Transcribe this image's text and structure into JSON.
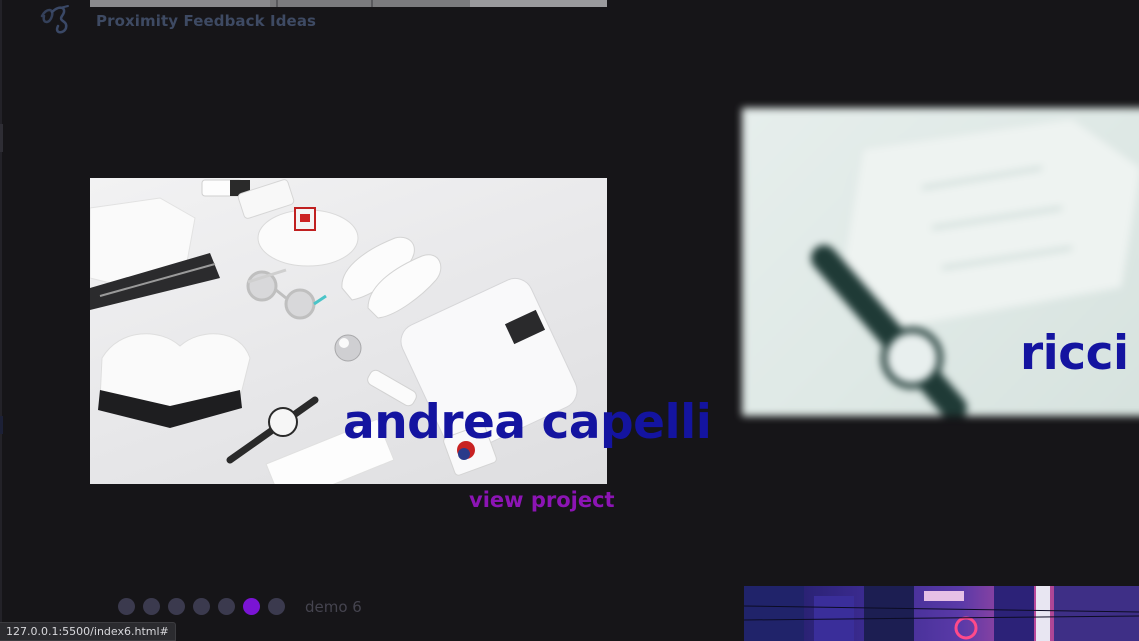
{
  "header": {
    "brand_title": "Proximity Feedback Ideas",
    "logo_icon": "scribble-logo-icon"
  },
  "slides": {
    "current": {
      "title": "andrea capelli",
      "link_label": "view project"
    },
    "next": {
      "title": "ricci h"
    }
  },
  "pagination": {
    "dots": [
      {
        "index": 1,
        "active": false
      },
      {
        "index": 2,
        "active": false
      },
      {
        "index": 3,
        "active": false
      },
      {
        "index": 4,
        "active": false
      },
      {
        "index": 5,
        "active": false
      },
      {
        "index": 6,
        "active": true
      },
      {
        "index": 7,
        "active": false
      }
    ],
    "label": "demo 6"
  },
  "status_bar": {
    "url": "127.0.0.1:5500/index6.html#"
  },
  "colors": {
    "background": "#161518",
    "title": "#1414a0",
    "link": "#8c14b4",
    "dot": "#3b3a4e",
    "dot_active": "#7a14d4"
  }
}
